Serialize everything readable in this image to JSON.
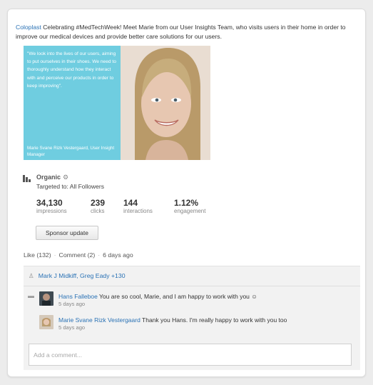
{
  "post": {
    "author": "Coloplast",
    "text": " Celebrating #MedTechWeek! Meet Marie from our User Insights Team, who visits users in their home in order to improve our medical devices and provide better care solutions for our users."
  },
  "image": {
    "quote": "\"We look into the lives of our users, aiming to put ourselves in their shoes. We need to thoroughly understand how they interact with and perceive our products in order to keep improving\".",
    "attribution": "Marie Svane Rizk Vestergaard, User Insight Manager"
  },
  "analytics": {
    "label": "Organic",
    "settings_icon": "gear-icon",
    "targeted": "Targeted to: All Followers",
    "metrics": [
      {
        "value": "34,130",
        "label": "impressions"
      },
      {
        "value": "239",
        "label": "clicks"
      },
      {
        "value": "144",
        "label": "interactions"
      },
      {
        "value": "1.12%",
        "label": "engagement"
      }
    ],
    "sponsor_label": "Sponsor update"
  },
  "social": {
    "like": "Like (132)",
    "comment": "Comment (2)",
    "time": "6 days ago",
    "separator": "·",
    "likers": "Mark J Midkiff, Greg Eady +130"
  },
  "comments": [
    {
      "author": "Hans Falleboe",
      "text": " You are so cool, Marie, and I am happy to work with you ☺",
      "time": "5 days ago"
    },
    {
      "author": "Marie Svane Rizk Vestergaard",
      "text": " Thank you Hans. I'm really happy to work with you too",
      "time": "5 days ago"
    }
  ],
  "composer": {
    "placeholder": "Add a comment..."
  },
  "colors": {
    "link": "#2a72b5",
    "quote_panel": "#6fcde0"
  }
}
